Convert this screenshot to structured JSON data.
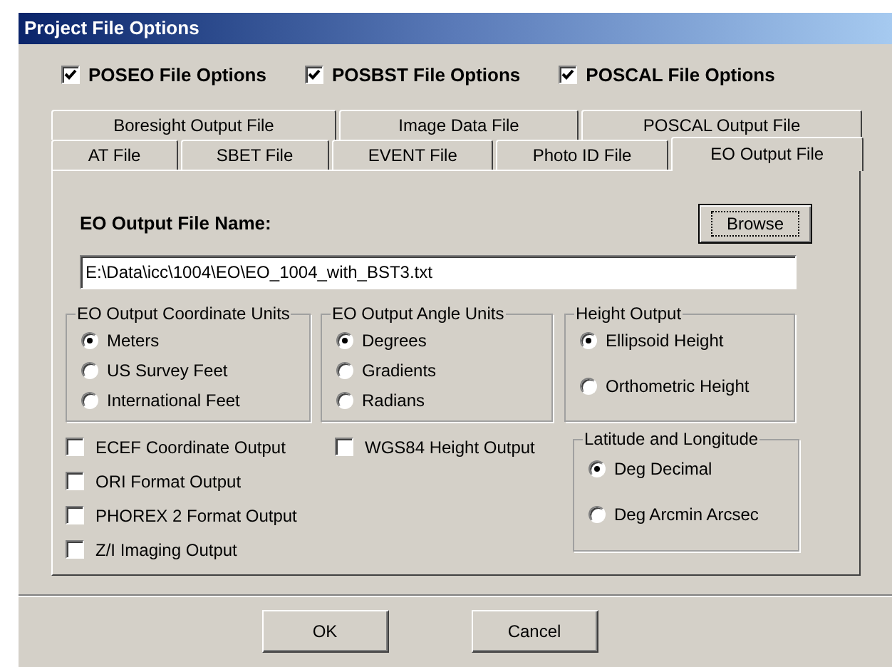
{
  "window": {
    "title": "Project File Options"
  },
  "module_options": [
    {
      "label": "POSEO File Options",
      "checked": true
    },
    {
      "label": "POSBST File Options",
      "checked": true
    },
    {
      "label": "POSCAL File Options",
      "checked": true
    }
  ],
  "tab_rows": [
    [
      {
        "label": "Boresight Output File",
        "selected": false
      },
      {
        "label": "Image Data File",
        "selected": false
      },
      {
        "label": "POSCAL Output File",
        "selected": false
      }
    ],
    [
      {
        "label": "AT File",
        "selected": false
      },
      {
        "label": "SBET File",
        "selected": false
      },
      {
        "label": "EVENT File",
        "selected": false
      },
      {
        "label": "Photo ID File",
        "selected": false
      },
      {
        "label": "EO Output File",
        "selected": true
      }
    ]
  ],
  "panel": {
    "file_name_label": "EO Output File Name:",
    "browse_button": "Browse",
    "file_name_value": "E:\\Data\\icc\\1004\\EO\\EO_1004_with_BST3.txt",
    "groups": [
      {
        "title": "EO Output Coordinate Units",
        "options": [
          {
            "label": "Meters",
            "selected": true
          },
          {
            "label": "US Survey Feet",
            "selected": false
          },
          {
            "label": "International Feet",
            "selected": false
          }
        ]
      },
      {
        "title": "EO Output Angle Units",
        "options": [
          {
            "label": "Degrees",
            "selected": true
          },
          {
            "label": "Gradients",
            "selected": false
          },
          {
            "label": "Radians",
            "selected": false
          }
        ]
      },
      {
        "title": "Height Output",
        "options": [
          {
            "label": "Ellipsoid Height",
            "selected": true
          },
          {
            "label": "Orthometric Height",
            "selected": false
          }
        ]
      }
    ],
    "left_checkboxes": [
      {
        "label": "ECEF Coordinate Output",
        "checked": false
      },
      {
        "label": "ORI Format Output",
        "checked": false
      },
      {
        "label": "PHOREX 2 Format Output",
        "checked": false
      },
      {
        "label": "Z/I Imaging Output",
        "checked": false
      }
    ],
    "middle_checkboxes": [
      {
        "label": "WGS84 Height Output",
        "checked": false
      }
    ],
    "lat_long_group": {
      "title": "Latitude and Longitude",
      "options": [
        {
          "label": "Deg Decimal",
          "selected": true
        },
        {
          "label": "Deg Arcmin Arcsec",
          "selected": false
        }
      ]
    }
  },
  "buttons": [
    "OK",
    "Cancel"
  ]
}
